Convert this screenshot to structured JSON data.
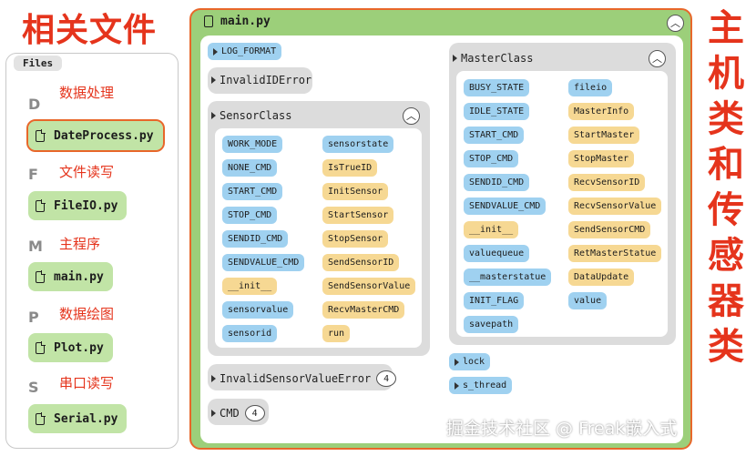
{
  "left_title": "相关文件",
  "right_title": [
    "主",
    "机",
    "类",
    "和",
    "传",
    "感",
    "器",
    "类"
  ],
  "files_tab": "Files",
  "file_groups": [
    {
      "letter": "D",
      "label": "数据处理",
      "file": "DateProcess.py"
    },
    {
      "letter": "F",
      "label": "文件读写",
      "file": "FileIO.py"
    },
    {
      "letter": "M",
      "label": "主程序",
      "file": "main.py"
    },
    {
      "letter": "P",
      "label": "数据绘图",
      "file": "Plot.py"
    },
    {
      "letter": "S",
      "label": "串口读写",
      "file": "Serial.py"
    }
  ],
  "main": {
    "title": "main.py",
    "log_format": "LOG_FORMAT",
    "invalid_id_error": "InvalidIDError",
    "sensor_class": {
      "title": "SensorClass",
      "left_items": [
        "WORK_MODE",
        "NONE_CMD",
        "START_CMD",
        "STOP_CMD",
        "SENDID_CMD",
        "SENDVALUE_CMD",
        "__init__",
        "sensorvalue",
        "sensorid"
      ],
      "right_items": [
        "sensorstate",
        "IsTrueID",
        "InitSensor",
        "StartSensor",
        "StopSensor",
        "SendSensorID",
        "SendSensorValue",
        "RecvMasterCMD",
        "run"
      ]
    },
    "invalid_sensor_value_error": {
      "label": "InvalidSensorValueError",
      "badge": "4"
    },
    "cmd": {
      "label": "CMD",
      "badge": "4"
    },
    "master_class": {
      "title": "MasterClass",
      "left_items": [
        "BUSY_STATE",
        "IDLE_STATE",
        "START_CMD",
        "STOP_CMD",
        "SENDID_CMD",
        "SENDVALUE_CMD",
        "__init__",
        "valuequeue",
        "__masterstatue",
        "INIT_FLAG",
        "savepath"
      ],
      "right_items": [
        "fileio",
        "MasterInfo",
        "StartMaster",
        "StopMaster",
        "RecvSensorID",
        "RecvSensorValue",
        "SendSensorCMD",
        "RetMasterStatue",
        "DataUpdate",
        "value"
      ]
    },
    "lock": "lock",
    "s_thread": "s_thread"
  },
  "watermark": "掘金技术社区 @ Freak嵌入式",
  "colors": {
    "accent_red": "#e5341c",
    "accent_orange": "#e8672a",
    "green": "#9ccf7a",
    "file_green": "#c1e4a6",
    "chip_blue": "#9fd1f0",
    "chip_yellow": "#f6d893",
    "gray_box": "#dcdcdc"
  }
}
